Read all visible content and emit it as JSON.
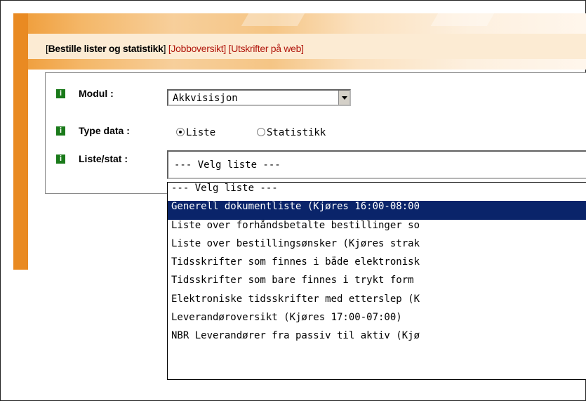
{
  "tabs": {
    "active": "Bestille lister og statistikk",
    "jobboversikt": "Jobboversikt",
    "utskrifter": "Utskrifter på web"
  },
  "form": {
    "info_glyph": "i",
    "modul_label": "Modul :",
    "modul_value": "Akkvisisjon",
    "type_label": "Type data :",
    "type_options": [
      {
        "label": "Liste",
        "checked": true
      },
      {
        "label": "Statistikk",
        "checked": false
      }
    ],
    "liste_label": "Liste/stat :",
    "liste_value": "--- Velg liste ---"
  },
  "dropdown": {
    "items": [
      "--- Velg liste ---",
      "Generell dokumentliste (Kjøres 16:00-08:00",
      "Liste over forhåndsbetalte bestillinger so",
      "Liste over bestillingsønsker (Kjøres strak",
      "Tidsskrifter som finnes i både elektronisk",
      "Tidsskrifter som bare finnes i trykt form",
      "Elektroniske tidsskrifter med etterslep (K",
      "Leverandøroversikt (Kjøres 17:00-07:00)",
      "NBR Leverandører fra passiv til aktiv (Kjø"
    ],
    "selected_index": 1
  },
  "colors": {
    "accent_orange": "#e98a22",
    "tab_link": "#b2180e",
    "selection": "#0a246a",
    "info_icon": "#1a7a1a"
  }
}
